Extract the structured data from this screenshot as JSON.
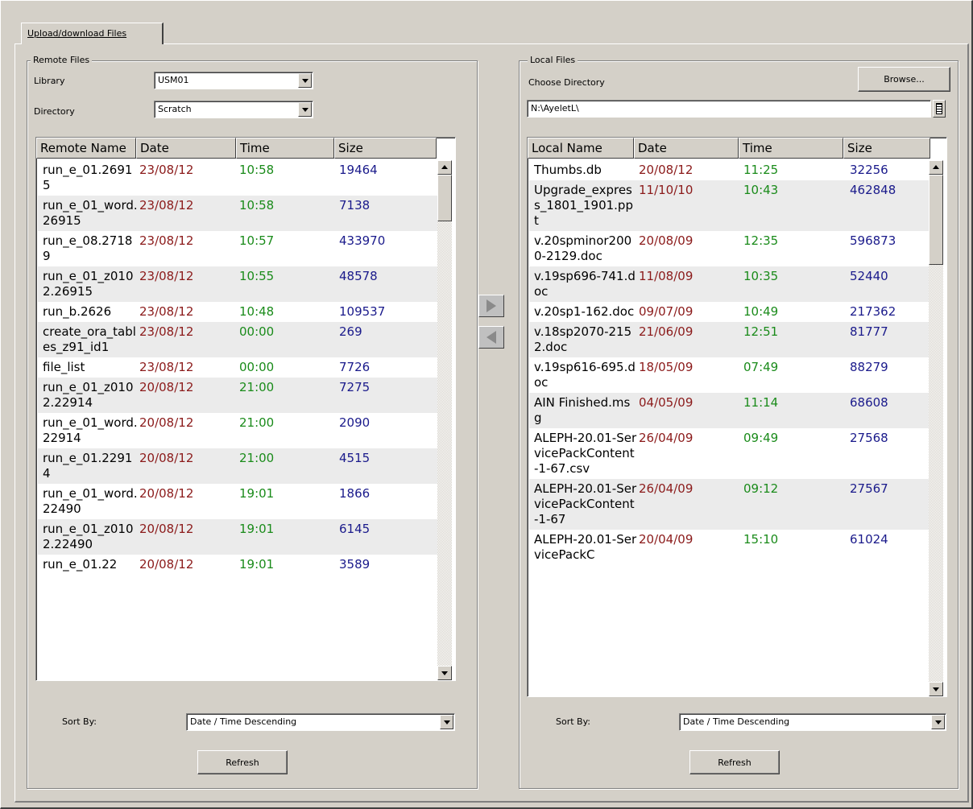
{
  "tab": {
    "label": "Upload/download Files"
  },
  "remote": {
    "group_title": "Remote Files",
    "library_label": "Library",
    "library_value": "USM01",
    "directory_label": "Directory",
    "directory_value": "Scratch",
    "columns": [
      "Remote Name",
      "Date",
      "Time",
      "Size"
    ],
    "rows": [
      {
        "name": "run_e_01.26915",
        "date": "23/08/12",
        "time": "10:58",
        "size": "19464"
      },
      {
        "name": "run_e_01_word.26915",
        "date": "23/08/12",
        "time": "10:58",
        "size": "7138"
      },
      {
        "name": "run_e_08.27189",
        "date": "23/08/12",
        "time": "10:57",
        "size": "433970"
      },
      {
        "name": "run_e_01_z0102.26915",
        "date": "23/08/12",
        "time": "10:55",
        "size": "48578"
      },
      {
        "name": "run_b.2626",
        "date": "23/08/12",
        "time": "10:48",
        "size": "109537"
      },
      {
        "name": "create_ora_tables_z91_id1",
        "date": "23/08/12",
        "time": "00:00",
        "size": "269"
      },
      {
        "name": "file_list",
        "date": "23/08/12",
        "time": "00:00",
        "size": "7726"
      },
      {
        "name": "run_e_01_z0102.22914",
        "date": "20/08/12",
        "time": "21:00",
        "size": "7275"
      },
      {
        "name": "run_e_01_word.22914",
        "date": "20/08/12",
        "time": "21:00",
        "size": "2090"
      },
      {
        "name": "run_e_01.22914",
        "date": "20/08/12",
        "time": "21:00",
        "size": "4515"
      },
      {
        "name": "run_e_01_word.22490",
        "date": "20/08/12",
        "time": "19:01",
        "size": "1866"
      },
      {
        "name": "run_e_01_z0102.22490",
        "date": "20/08/12",
        "time": "19:01",
        "size": "6145"
      },
      {
        "name": "run_e_01.22",
        "date": "20/08/12",
        "time": "19:01",
        "size": "3589"
      }
    ],
    "sort_label": "Sort By:",
    "sort_value": "Date / Time Descending",
    "refresh_label": "Refresh"
  },
  "local": {
    "group_title": "Local Files",
    "choose_label": "Choose Directory",
    "browse_label": "Browse...",
    "path_value": "N:\\AyeletL\\",
    "columns": [
      "Local Name",
      "Date",
      "Time",
      "Size"
    ],
    "rows": [
      {
        "name": "Thumbs.db",
        "date": "20/08/12",
        "time": "11:25",
        "size": "32256"
      },
      {
        "name": "Upgrade_express_1801_1901.ppt",
        "date": "11/10/10",
        "time": "10:43",
        "size": "462848"
      },
      {
        "name": "v.20spminor2000-2129.doc",
        "date": "20/08/09",
        "time": "12:35",
        "size": "596873"
      },
      {
        "name": "v.19sp696-741.doc",
        "date": "11/08/09",
        "time": "10:35",
        "size": "52440"
      },
      {
        "name": "v.20sp1-162.doc",
        "date": "09/07/09",
        "time": "10:49",
        "size": "217362"
      },
      {
        "name": "v.18sp2070-2152.doc",
        "date": "21/06/09",
        "time": "12:51",
        "size": "81777"
      },
      {
        "name": "v.19sp616-695.doc",
        "date": "18/05/09",
        "time": "07:49",
        "size": "88279"
      },
      {
        "name": "AIN Finished.msg",
        "date": "04/05/09",
        "time": "11:14",
        "size": "68608"
      },
      {
        "name": "ALEPH-20.01-ServicePackContent-1-67.csv",
        "date": "26/04/09",
        "time": "09:49",
        "size": "27568"
      },
      {
        "name": "ALEPH-20.01-ServicePackContent-1-67",
        "date": "26/04/09",
        "time": "09:12",
        "size": "27567"
      },
      {
        "name": "ALEPH-20.01-ServicePackC",
        "date": "20/04/09",
        "time": "15:10",
        "size": "61024"
      }
    ],
    "sort_label": "Sort By:",
    "sort_value": "Date / Time Descending",
    "refresh_label": "Refresh"
  },
  "icons": {
    "upload": "arrow-right-icon",
    "download": "arrow-left-icon",
    "dropdown": "chevron-down-icon"
  }
}
